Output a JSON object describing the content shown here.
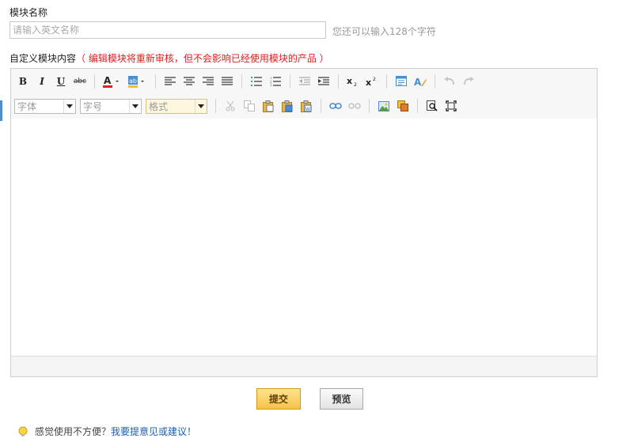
{
  "module_name": {
    "label": "模块名称",
    "placeholder": "请输入英文名称",
    "value": "",
    "hint": "您还可以输入128个字符"
  },
  "module_content": {
    "label": "自定义模块内容",
    "warning": "（ 编辑模块将重新审核，但不会影响已经使用模块的产品 ）"
  },
  "toolbar": {
    "row1": [
      {
        "icon": "bold-icon",
        "text": "B"
      },
      {
        "icon": "italic-icon",
        "text": "I"
      },
      {
        "icon": "underline-icon",
        "text": "U"
      },
      {
        "icon": "strikethrough-icon",
        "text": "abc"
      },
      {
        "icon": "font-color-icon"
      },
      {
        "icon": "background-color-icon",
        "text": "ab"
      },
      {
        "icon": "align-left-icon"
      },
      {
        "icon": "align-center-icon"
      },
      {
        "icon": "align-right-icon"
      },
      {
        "icon": "align-justify-icon"
      },
      {
        "icon": "unordered-list-icon"
      },
      {
        "icon": "ordered-list-icon"
      },
      {
        "icon": "outdent-icon"
      },
      {
        "icon": "indent-icon"
      },
      {
        "icon": "subscript-icon"
      },
      {
        "icon": "superscript-icon"
      },
      {
        "icon": "source-icon"
      },
      {
        "icon": "remove-format-icon"
      },
      {
        "icon": "undo-icon"
      },
      {
        "icon": "redo-icon"
      }
    ],
    "font_family": "字体",
    "font_size": "字号",
    "format": "格式",
    "row2": [
      {
        "icon": "cut-icon"
      },
      {
        "icon": "copy-icon"
      },
      {
        "icon": "paste-icon"
      },
      {
        "icon": "paste-text-icon"
      },
      {
        "icon": "paste-word-icon"
      },
      {
        "icon": "link-icon"
      },
      {
        "icon": "unlink-icon"
      },
      {
        "icon": "image-icon"
      },
      {
        "icon": "flash-icon"
      },
      {
        "icon": "preview-icon"
      },
      {
        "icon": "maximize-icon"
      }
    ]
  },
  "colors": {
    "accent": "#4a8fd0",
    "warning": "#e02020",
    "submit_bg": "#f7c24a",
    "link": "#1a5fb4"
  },
  "actions": {
    "submit": "提交",
    "preview": "预览"
  },
  "footer": {
    "text": "感觉使用不方便？",
    "link": "我要提意见或建议！"
  }
}
